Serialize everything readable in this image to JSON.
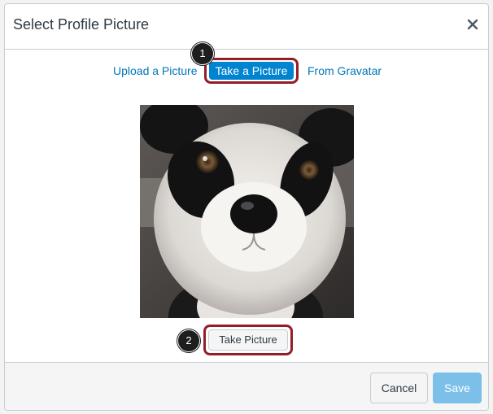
{
  "dialog": {
    "title": "Select Profile Picture",
    "close_symbol": "×"
  },
  "tabs": {
    "upload_label": "Upload a Picture",
    "take_label": "Take a Picture",
    "gravatar_label": "From Gravatar",
    "active_tab": "Take a Picture"
  },
  "callouts": {
    "one": "1",
    "two": "2"
  },
  "camera": {
    "take_picture_label": "Take Picture",
    "preview_subject": "panda plush toy"
  },
  "footer": {
    "cancel_label": "Cancel",
    "save_label": "Save"
  },
  "colors": {
    "link": "#0076b8",
    "active_tab_bg": "#0084d1",
    "highlight_border": "#951d28",
    "save_disabled_bg": "#7cc0ea"
  }
}
